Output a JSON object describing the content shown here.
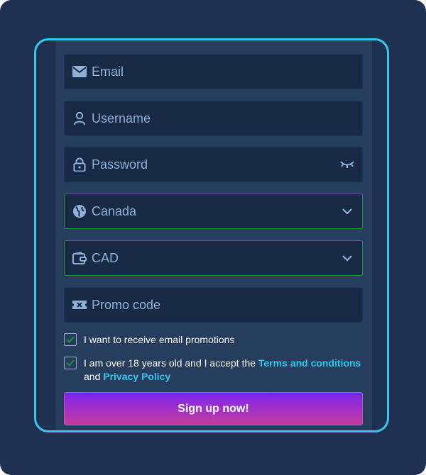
{
  "form": {
    "email": {
      "placeholder": "Email",
      "icon": "envelope-icon"
    },
    "username": {
      "placeholder": "Username",
      "icon": "user-icon"
    },
    "password": {
      "placeholder": "Password",
      "icon": "lock-icon",
      "toggle_icon": "eye-closed-icon"
    },
    "country": {
      "value": "Canada",
      "icon": "globe-icon"
    },
    "currency": {
      "value": "CAD",
      "icon": "wallet-icon"
    },
    "promo": {
      "placeholder": "Promo code",
      "icon": "ticket-icon"
    },
    "email_promotions": {
      "label": "I want to receive email promotions",
      "checked": true
    },
    "age_terms": {
      "text_before": "I am over 18 years old and I accept the ",
      "terms_link": "Terms and conditions",
      "text_middle": "and ",
      "privacy_link": "Privacy Policy",
      "checked": true
    },
    "submit_label": "Sign up now!"
  },
  "colors": {
    "background": "#1f3150",
    "frame_border": "#36c6ef",
    "field_bg": "#172945",
    "field_text": "#8fb1d8",
    "valid_border": "#1e8e3e",
    "link": "#33c6ee",
    "button_gradient_top": "#7a25ec",
    "button_gradient_bottom": "#c23d9a"
  }
}
